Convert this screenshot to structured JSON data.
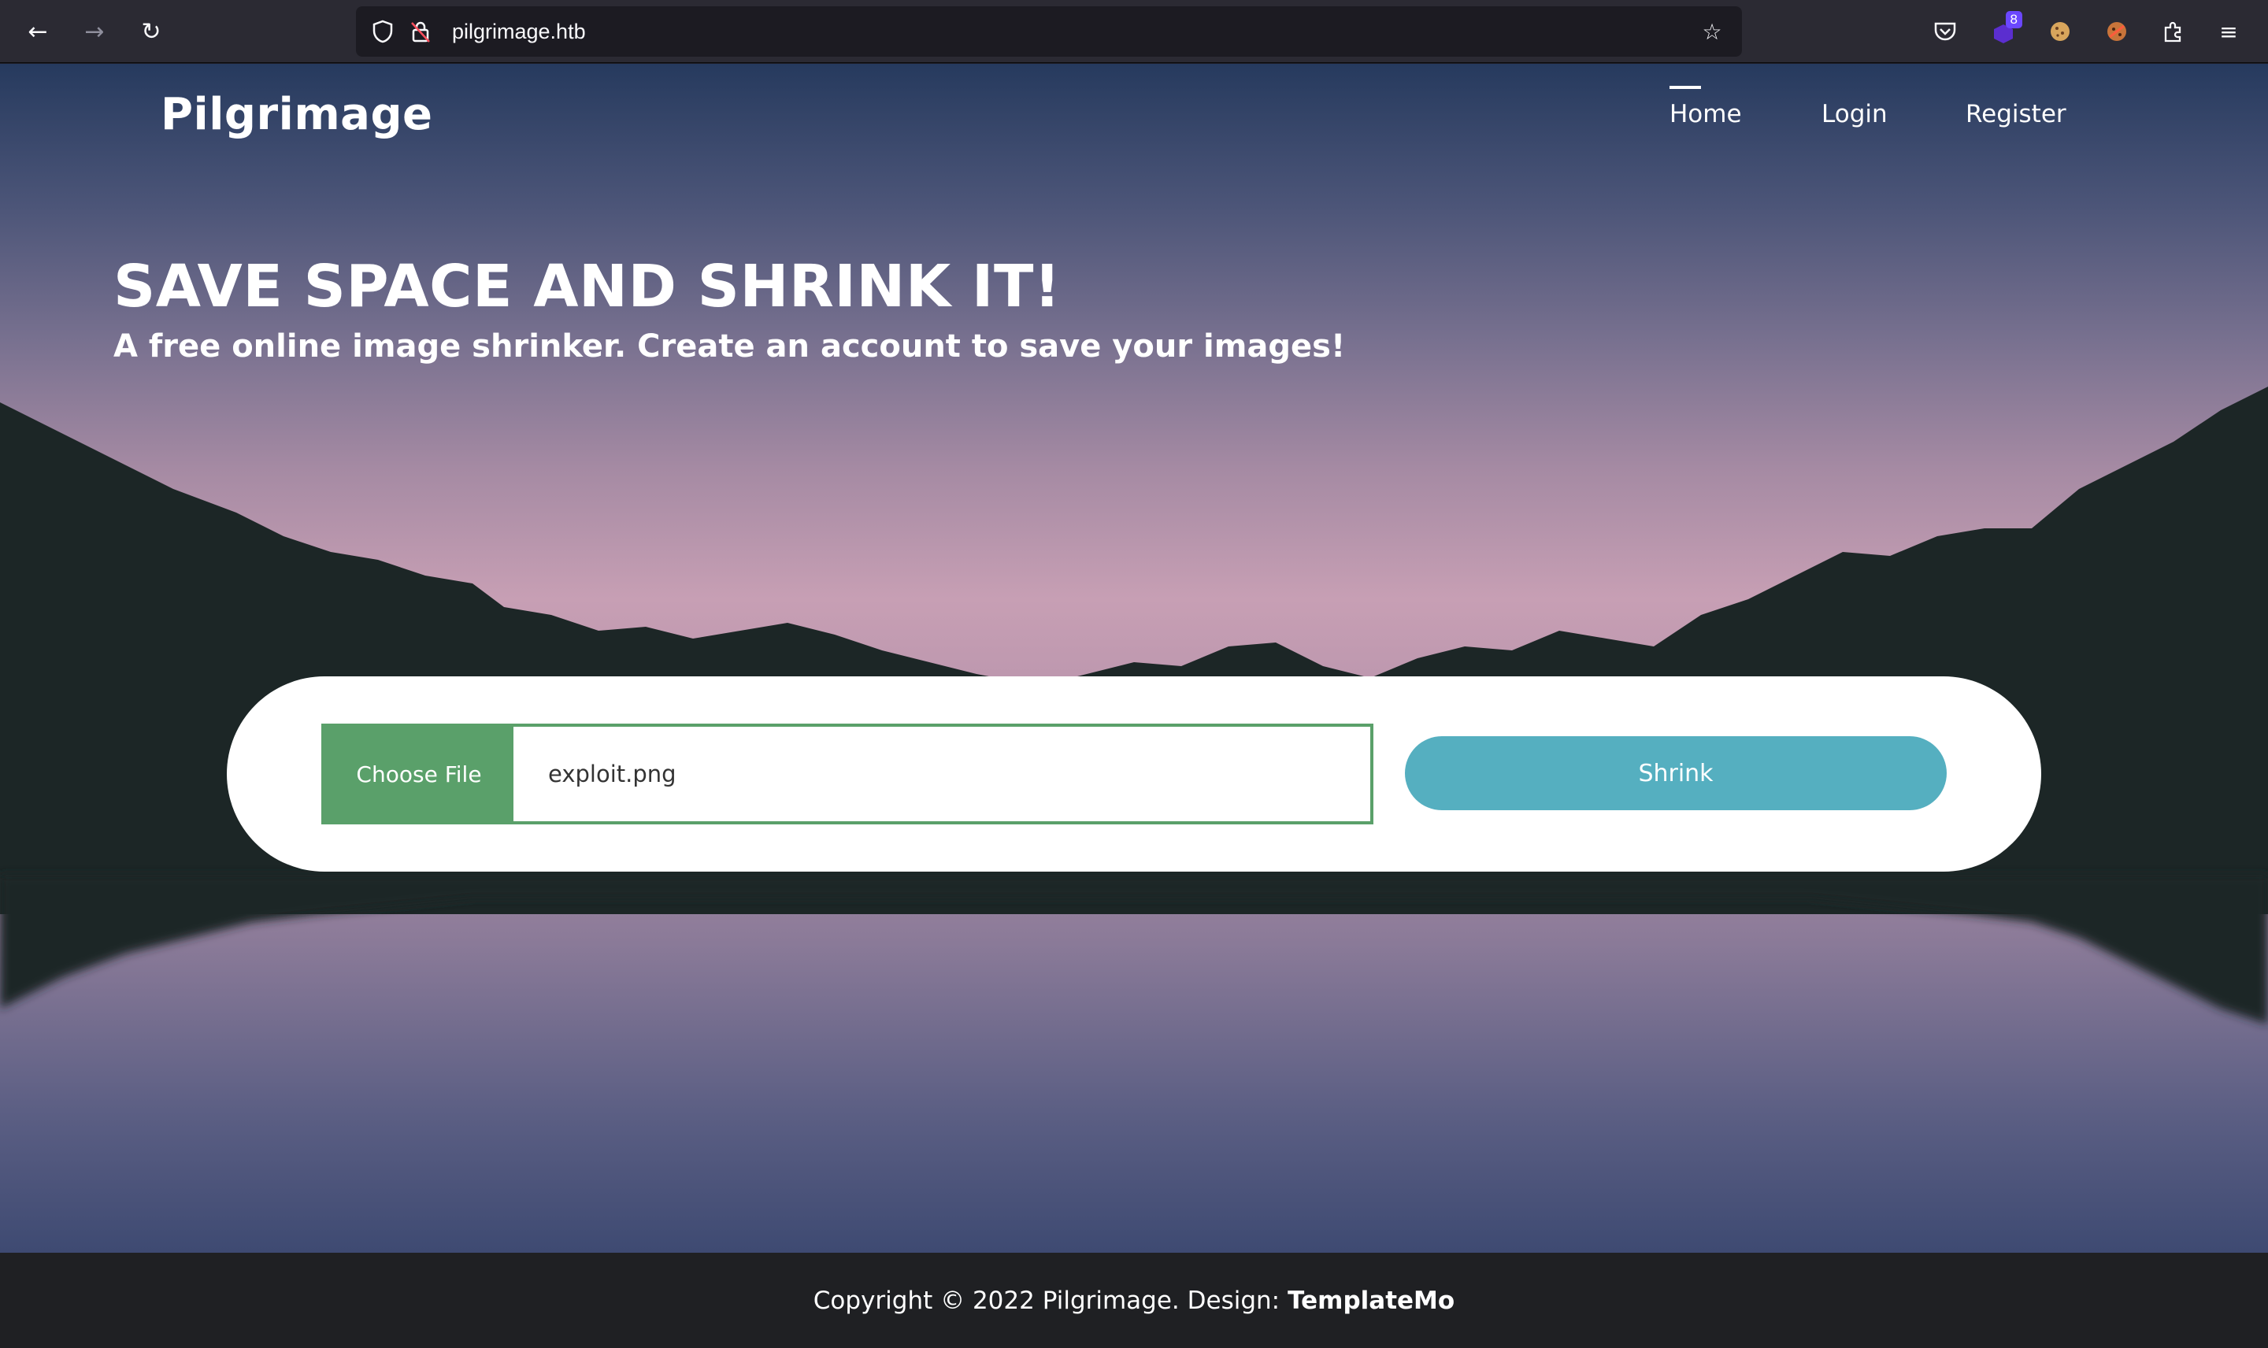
{
  "browser": {
    "url": "pilgrimage.htb",
    "extension_badge": "8"
  },
  "site": {
    "brand": "Pilgrimage",
    "nav": [
      {
        "label": "Home",
        "active": true
      },
      {
        "label": "Login",
        "active": false
      },
      {
        "label": "Register",
        "active": false
      }
    ]
  },
  "hero": {
    "headline": "SAVE SPACE AND SHRINK IT!",
    "subline": "A free online image shrinker. Create an account to save your images!"
  },
  "upload": {
    "choose_label": "Choose File",
    "file_name": "exploit.png",
    "submit_label": "Shrink"
  },
  "footer": {
    "text": "Copyright © 2022 Pilgrimage. Design:",
    "link": "TemplateMo"
  },
  "colors": {
    "accent_green": "#5aa06a",
    "button_teal": "#55afc0",
    "mountains": "#1c2626"
  }
}
